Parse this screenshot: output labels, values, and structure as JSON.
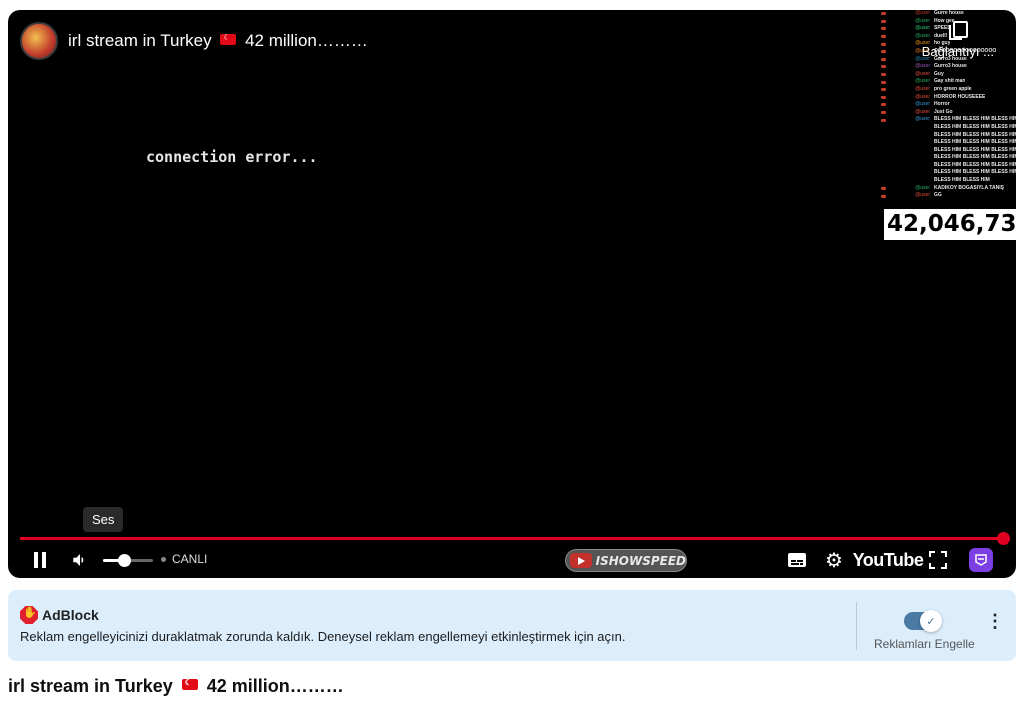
{
  "player": {
    "top_title": "irl stream in Turkey",
    "top_title_suffix": "42 million………",
    "connection_error": "connection error...",
    "copy_label": "Bağlantıyı ...",
    "counter": "42,046,73",
    "tooltip": "Ses",
    "live_label": "CANLI",
    "channel_logo_text": "ISHOWSPEED",
    "youtube_logo": "YouTube",
    "volume_level": 0.42,
    "progress": 1.0,
    "chat": [
      {
        "user": "@user",
        "msg": "Gurre house",
        "color": "#c0392b"
      },
      {
        "user": "@user",
        "msg": "How gee",
        "color": "#27ae60"
      },
      {
        "user": "@user",
        "msg": "SPEED ?",
        "color": "#2ecc71"
      },
      {
        "user": "@user",
        "msg": "duell!",
        "color": "#27ae60"
      },
      {
        "user": "@user",
        "msg": "ho guy",
        "color": "#f39c12"
      },
      {
        "user": "@user",
        "msg": "OOOOOOOOOOOOOOOO",
        "color": "#e67e22"
      },
      {
        "user": "@user",
        "msg": "Gurro3 house",
        "color": "#2980b9"
      },
      {
        "user": "@user",
        "msg": "Gurro3 house",
        "color": "#9b59b6"
      },
      {
        "user": "@user",
        "msg": "Guy",
        "color": "#e74c3c"
      },
      {
        "user": "@user",
        "msg": "Gay shit man",
        "color": "#27ae60"
      },
      {
        "user": "@user",
        "msg": "pro green apple",
        "color": "#e74c3c"
      },
      {
        "user": "@user",
        "msg": "HORROR HOUSEEEE",
        "color": "#e74c3c"
      },
      {
        "user": "@user",
        "msg": "Horror",
        "color": "#3498db"
      },
      {
        "user": "@user",
        "msg": "Just Go",
        "color": "#e74c3c"
      },
      {
        "user": "@user",
        "msg": "BLESS HIM BLESS HIM BLESS HIM",
        "color": "#3498db"
      },
      {
        "user": "",
        "msg": "BLESS HIM BLESS HIM BLESS HIM",
        "color": "#000"
      },
      {
        "user": "",
        "msg": "BLESS HIM BLESS HIM BLESS HIM",
        "color": "#000"
      },
      {
        "user": "",
        "msg": "BLESS HIM BLESS HIM BLESS HIM",
        "color": "#000"
      },
      {
        "user": "",
        "msg": "BLESS HIM BLESS HIM BLESS HIM",
        "color": "#000"
      },
      {
        "user": "",
        "msg": "BLESS HIM BLESS HIM BLESS HIM",
        "color": "#000"
      },
      {
        "user": "",
        "msg": "BLESS HIM BLESS HIM BLESS HIM",
        "color": "#000"
      },
      {
        "user": "",
        "msg": "BLESS HIM BLESS HIM BLESS HIM",
        "color": "#000"
      },
      {
        "user": "",
        "msg": "BLESS HIM BLESS HIM",
        "color": "#000"
      },
      {
        "user": "@user",
        "msg": "KADIKÖY BOĞASIYLA TANIŞ",
        "color": "#27ae60"
      },
      {
        "user": "@user",
        "msg": "GG",
        "color": "#e74c3c"
      }
    ]
  },
  "adblock": {
    "brand": "AdBlock",
    "message": "Reklam engelleyicinizi duraklatmak zorunda kaldık. Deneysel reklam engellemeyi etkinleştirmek için açın.",
    "toggle_label": "Reklamları Engelle",
    "toggle_on": true
  },
  "video": {
    "title": "irl stream in Turkey",
    "title_suffix": "42 million………"
  },
  "colors": {
    "progress": "#e00022",
    "adblock_bg": "#dceefc",
    "extension": "#7b3fe4"
  }
}
